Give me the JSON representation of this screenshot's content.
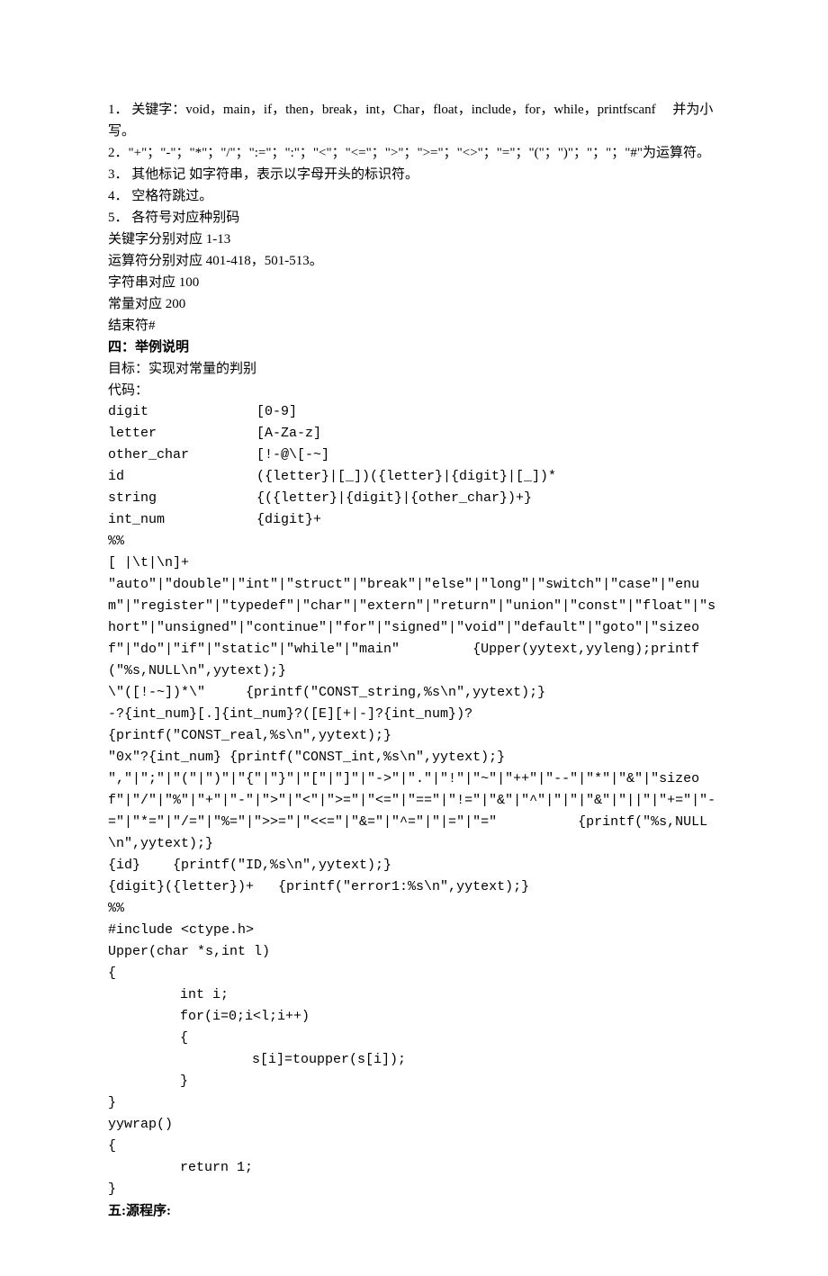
{
  "items": {
    "1": "1． 关键字：void，main，if，then，break，int，Char，float，include，for，while，printfscanf     并为小写。",
    "2": "2．\"+\"；\"-\"；\"*\"；\"/\"；\":=\"；\":\"；\"<\"；\"<=\"；\">\"；\">=\"；\"<>\"；\"=\"；\"(\"；\")\"；\"；\"；\"#\"为运算符。",
    "3": "3． 其他标记 如字符串，表示以字母开头的标识符。",
    "4": "4． 空格符跳过。",
    "5": "5． 各符号对应种别码"
  },
  "codes": {
    "kw": "关键字分别对应 1-13",
    "op": "运算符分别对应 401-418，501-513。",
    "str": "字符串对应 100",
    "const": "常量对应 200",
    "end": "结束符#"
  },
  "sec4": {
    "title": "四：举例说明",
    "goal": "目标：实现对常量的判别",
    "codelabel": "代码："
  },
  "defs": {
    "digit_k": "digit",
    "digit_v": "[0-9]",
    "letter_k": "letter",
    "letter_v": "[A-Za-z]",
    "other_k": "other_char",
    "other_v": "[!-@\\[-~]",
    "id_k": "id",
    "id_v": "({letter}|[_])({letter}|{digit}|[_])*",
    "string_k": "string",
    "string_v": "{({letter}|{digit}|{other_char})+}",
    "int_k": "int_num",
    "int_v": "{digit}+"
  },
  "lex": {
    "pp1": "%%",
    "ws": "[ |\\t|\\n]+",
    "kw": "\"auto\"|\"double\"|\"int\"|\"struct\"|\"break\"|\"else\"|\"long\"|\"switch\"|\"case\"|\"enum\"|\"register\"|\"typedef\"|\"char\"|\"extern\"|\"return\"|\"union\"|\"const\"|\"float\"|\"short\"|\"unsigned\"|\"continue\"|\"for\"|\"signed\"|\"void\"|\"default\"|\"goto\"|\"sizeof\"|\"do\"|\"if\"|\"static\"|\"while\"|\"main\"         {Upper(yytext,yyleng);printf(\"%s,NULL\\n\",yytext);}",
    "strrule": "\\\"([!-~])*\\\"     {printf(\"CONST_string,%s\\n\",yytext);}",
    "real1": "-?{int_num}[.]{int_num}?([E][+|-]?{int_num})?",
    "real2": "{printf(\"CONST_real,%s\\n\",yytext);}",
    "intrule": "\"0x\"?{int_num} {printf(\"CONST_int,%s\\n\",yytext);}",
    "ops": "\",\"|\";\"|\"(\"|\")\"|\"{\"|\"}\"|\"[\"|\"]\"|\"->\"|\".\"|\"!\"|\"~\"|\"++\"|\"--\"|\"*\"|\"&\"|\"sizeof\"|\"/\"|\"%\"|\"+\"|\"-\"|\">\"|\"<\"|\">=\"|\"<=\"|\"==\"|\"!=\"|\"&\"|\"^\"|\"|\"|\"&\"|\"||\"|\"+=\"|\"-=\"|\"*=\"|\"/=\"|\"%=\"|\">>=\"|\"<<=\"|\"&=\"|\"^=\"|\"|=\"|\"=\"          {printf(\"%s,NULL\\n\",yytext);}",
    "idrule": "{id}    {printf(\"ID,%s\\n\",yytext);}",
    "err": "{digit}({letter})+   {printf(\"error1:%s\\n\",yytext);}",
    "pp2": "%%",
    "inc": "#include <ctype.h>",
    "upperdecl": "Upper(char *s,int l)",
    "ob": "{",
    "inti": "int i;",
    "for": "for(i=0;i<l;i++)",
    "ob2": "{",
    "toup": "s[i]=toupper(s[i]);",
    "cb2": "}",
    "cb": "}",
    "wrap": "yywrap()",
    "ob3": "{",
    "ret": "return 1;",
    "cb3": "}"
  },
  "sec5": {
    "title": "五:源程序:"
  }
}
